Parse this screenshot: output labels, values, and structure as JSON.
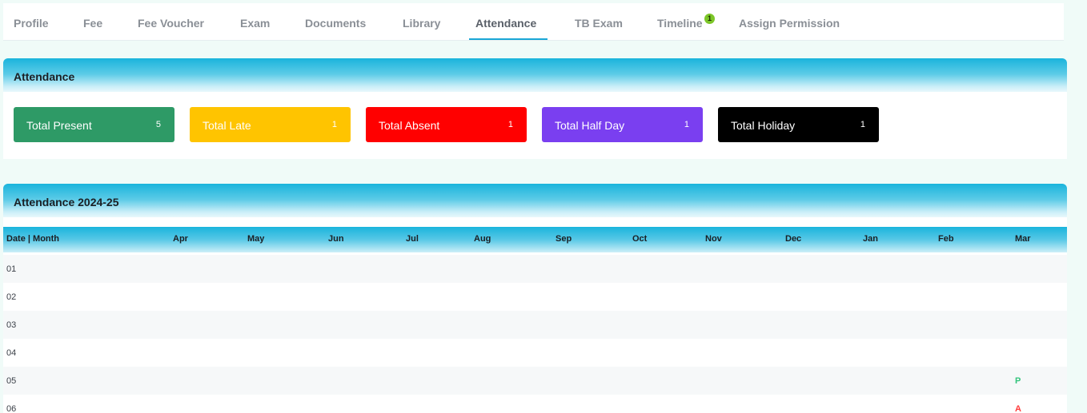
{
  "tabs": [
    {
      "label": "Profile"
    },
    {
      "label": "Fee"
    },
    {
      "label": "Fee Voucher"
    },
    {
      "label": "Exam"
    },
    {
      "label": "Documents"
    },
    {
      "label": "Library"
    },
    {
      "label": "Attendance",
      "active": true
    },
    {
      "label": "TB Exam"
    },
    {
      "label": "Timeline",
      "badge": "1"
    },
    {
      "label": "Assign Permission"
    }
  ],
  "summary": {
    "title": "Attendance",
    "stats": [
      {
        "label": "Total Present",
        "count": "5",
        "color": "#2e9a66"
      },
      {
        "label": "Total Late",
        "count": "1",
        "color": "#ffc400"
      },
      {
        "label": "Total Absent",
        "count": "1",
        "color": "#ff0000"
      },
      {
        "label": "Total Half Day",
        "count": "1",
        "color": "#7a3ff0"
      },
      {
        "label": "Total Holiday",
        "count": "1",
        "color": "#000000"
      }
    ]
  },
  "yearly": {
    "title": "Attendance 2024-25",
    "columns": [
      "Date | Month",
      "Apr",
      "May",
      "Jun",
      "Jul",
      "Aug",
      "Sep",
      "Oct",
      "Nov",
      "Dec",
      "Jan",
      "Feb",
      "Mar"
    ],
    "rows": [
      {
        "day": "01",
        "mar": ""
      },
      {
        "day": "02",
        "mar": ""
      },
      {
        "day": "03",
        "mar": ""
      },
      {
        "day": "04",
        "mar": ""
      },
      {
        "day": "05",
        "mar": "P"
      },
      {
        "day": "06",
        "mar": "A"
      }
    ],
    "status_colors": {
      "P": "#34c47c",
      "A": "#ff3b3b"
    }
  }
}
